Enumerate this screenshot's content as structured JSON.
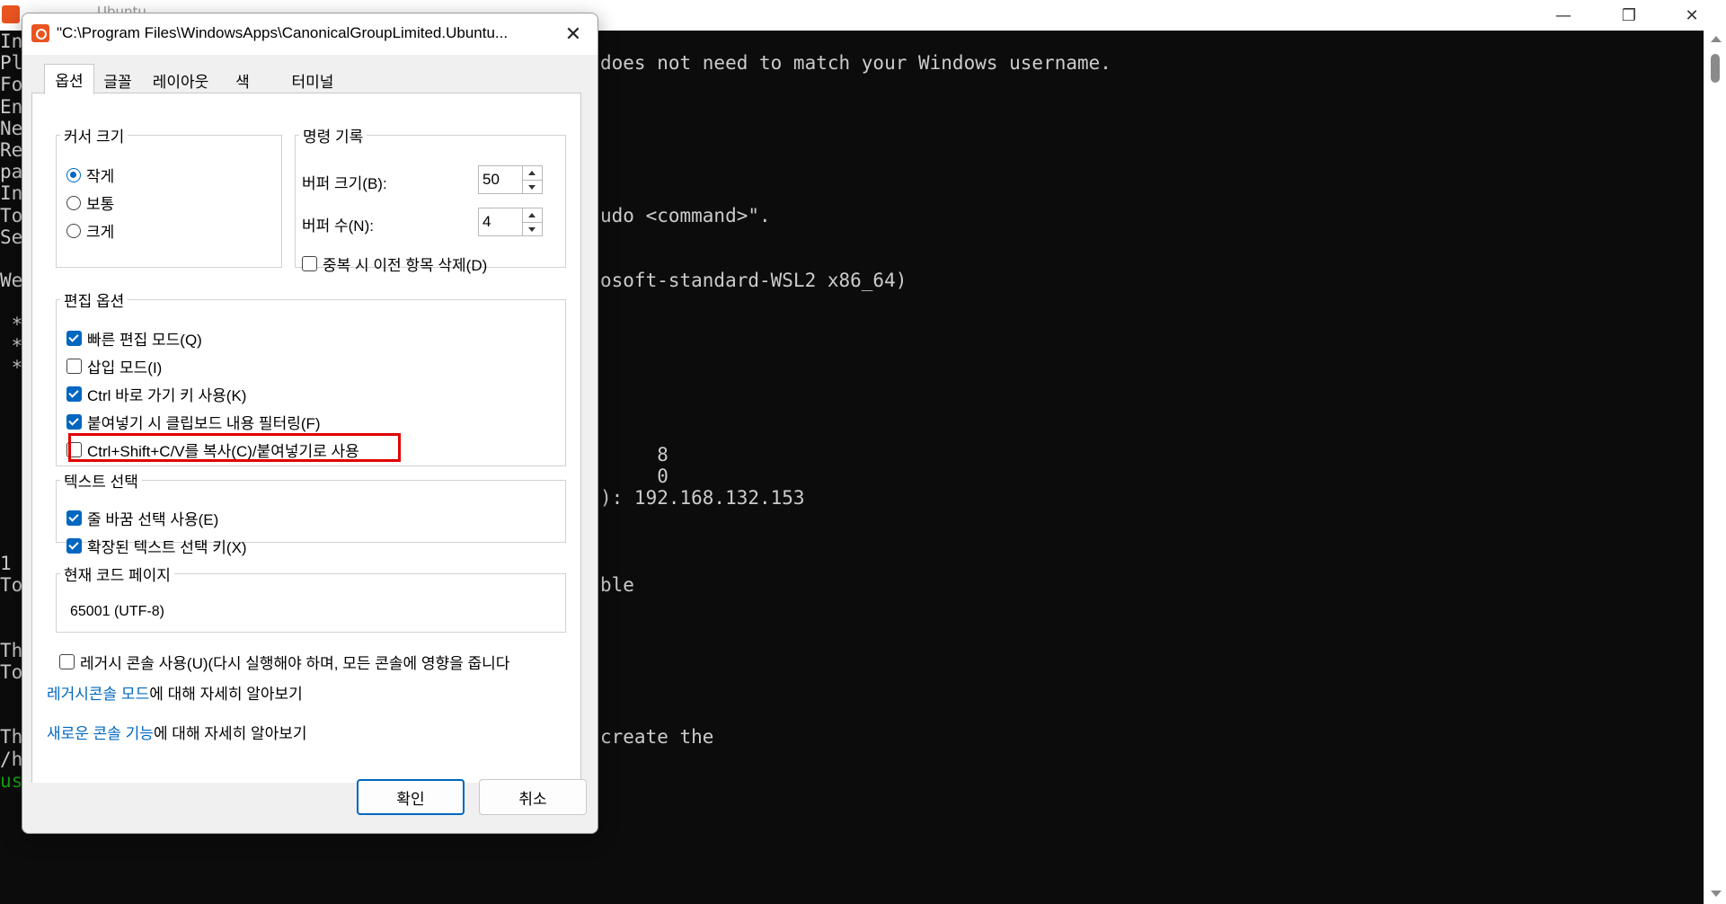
{
  "console": {
    "window_title": "Ubuntu",
    "partial_left_lines": [
      "In",
      "Pl",
      "Fo",
      "En",
      "Ne",
      "Re",
      "pa",
      "In",
      "To",
      "Se",
      "",
      "We",
      "",
      " *",
      " *",
      " *",
      "",
      "",
      "",
      "",
      "",
      "",
      "",
      "",
      "1",
      "To",
      "",
      "",
      "Th",
      "To",
      "",
      "",
      "Th",
      "/h",
      "us"
    ],
    "visible_lines": [
      {
        "text": "does not need to match your Windows username.",
        "row": 1
      },
      {
        "text": "udo <command>\".",
        "row": 8
      },
      {
        "text": "osoft-standard-WSL2 x86_64)",
        "row": 11
      },
      {
        "text": "     8",
        "row": 19
      },
      {
        "text": "     0",
        "row": 20
      },
      {
        "text": "): 192.168.132.153",
        "row": 21
      },
      {
        "text": "ble",
        "row": 25
      },
      {
        "text": "create the",
        "row": 32
      }
    ],
    "prompt_color": "#13a10e",
    "text_color": "#cccccc",
    "background": "#0c0c0c"
  },
  "window_controls": {
    "minimize": "—",
    "maximize": "❐",
    "close": "✕"
  },
  "dialog": {
    "title": "\"C:\\Program Files\\WindowsApps\\CanonicalGroupLimited.Ubuntu...",
    "close_glyph": "✕",
    "tabs": [
      "옵션",
      "글꼴",
      "레이아웃",
      "색",
      "터미널"
    ],
    "active_tab": "옵션",
    "cursor_size": {
      "legend": "커서 크기",
      "options": [
        "작게",
        "보통",
        "크게"
      ],
      "selected": "작게"
    },
    "command_history": {
      "legend": "명령 기록",
      "buffer_size_label": "버퍼 크기(B):",
      "buffer_size_value": "50",
      "buffer_count_label": "버퍼 수(N):",
      "buffer_count_value": "4",
      "discard_duplicates_label": "중복 시 이전 항목 삭제(D)",
      "discard_duplicates_checked": false
    },
    "edit_options": {
      "legend": "편집 옵션",
      "items": [
        {
          "label": "빠른 편집 모드(Q)",
          "checked": true
        },
        {
          "label": "삽입 모드(I)",
          "checked": false
        },
        {
          "label": "Ctrl 바로 가기 키 사용(K)",
          "checked": true
        },
        {
          "label": "붙여넣기 시 클립보드 내용 필터링(F)",
          "checked": true
        },
        {
          "label": "Ctrl+Shift+C/V를 복사(C)/붙여넣기로 사용",
          "checked": false
        }
      ]
    },
    "text_selection": {
      "legend": "텍스트 선택",
      "items": [
        {
          "label": "줄 바꿈 선택 사용(E)",
          "checked": true
        },
        {
          "label": "확장된 텍스트 선택 키(X)",
          "checked": true
        }
      ]
    },
    "code_page": {
      "legend": "현재 코드 페이지",
      "value": "65001 (UTF-8)"
    },
    "legacy_console": {
      "label": "레거시 콘솔 사용(U)(다시 실행해야 하며, 모든 콘솔에 영향을 줍니다",
      "checked": false
    },
    "legacy_link": {
      "link": "레거시콘솔 모드",
      "rest": "에 대해 자세히 알아보기"
    },
    "new_features_link": {
      "link": "새로운 콘솔 기능",
      "rest": "에 대해 자세히 알아보기"
    },
    "ok_label": "확인",
    "cancel_label": "취소",
    "highlight_color": "#e00000",
    "accent_color": "#0067c0"
  }
}
